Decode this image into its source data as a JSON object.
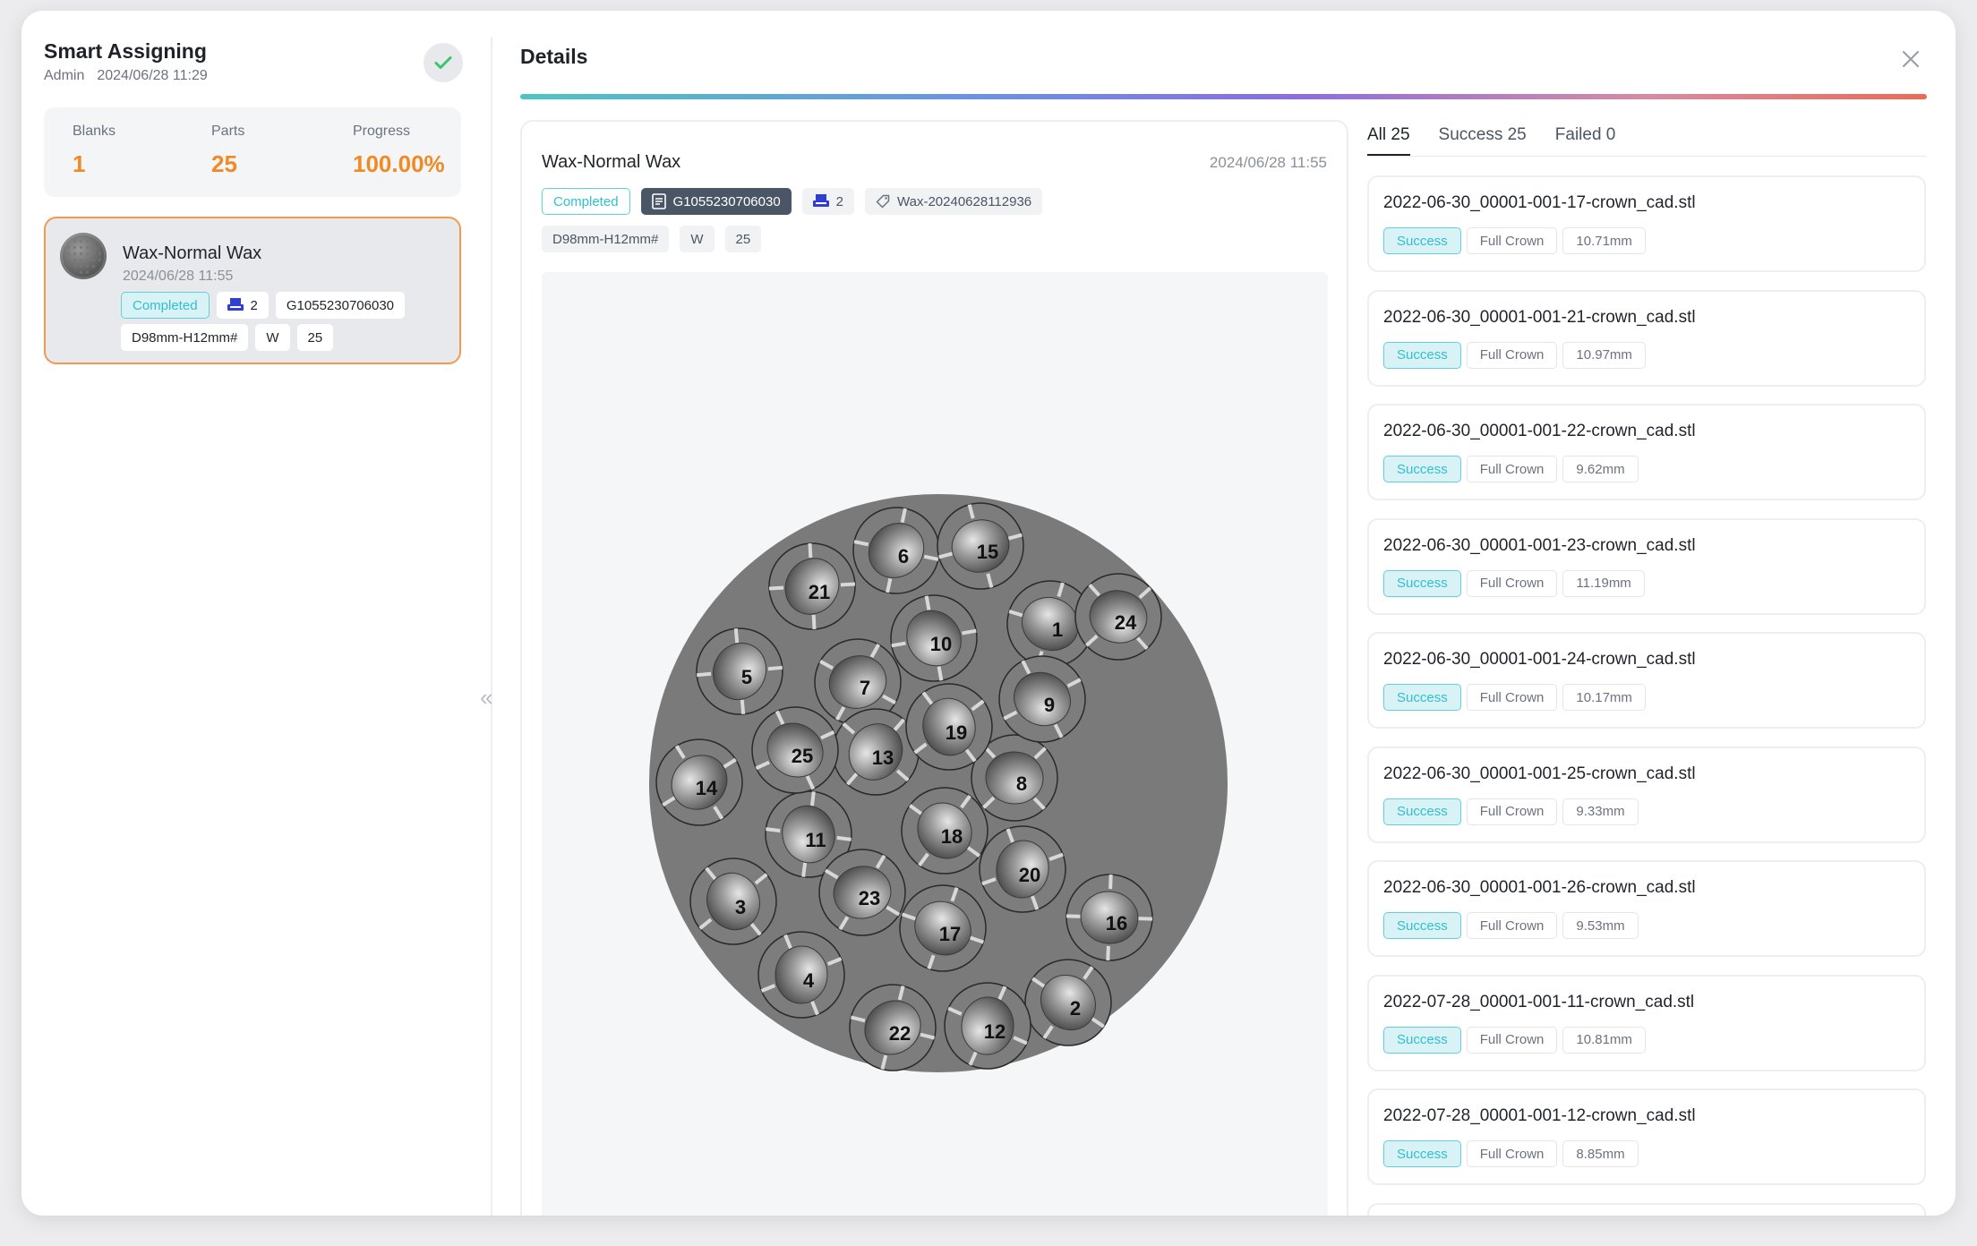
{
  "left": {
    "title": "Smart Assigning",
    "user": "Admin",
    "datetime": "2024/06/28 11:29",
    "stats": [
      {
        "label": "Blanks",
        "value": "1"
      },
      {
        "label": "Parts",
        "value": "25"
      },
      {
        "label": "Progress",
        "value": "100.00%"
      }
    ],
    "job": {
      "name": "Wax-Normal Wax",
      "time": "2024/06/28 11:55",
      "status": "Completed",
      "count": "2",
      "id": "G1055230706030",
      "size": "D98mm-H12mm#",
      "material_code": "W",
      "parts": "25"
    }
  },
  "details": {
    "title": "Details",
    "name": "Wax-Normal Wax",
    "time": "2024/06/28 11:55",
    "status": "Completed",
    "id": "G1055230706030",
    "count": "2",
    "label": "Wax-20240628112936",
    "size": "D98mm-H12mm#",
    "material_code": "W",
    "parts": "25",
    "disc_teeth": [
      "1",
      "2",
      "3",
      "4",
      "5",
      "6",
      "7",
      "8",
      "9",
      "10",
      "11",
      "12",
      "13",
      "14",
      "15",
      "16",
      "17",
      "18",
      "19",
      "20",
      "21",
      "22",
      "23",
      "24",
      "25"
    ]
  },
  "tabs": [
    {
      "label": "All 25"
    },
    {
      "label": "Success 25"
    },
    {
      "label": "Failed 0"
    }
  ],
  "items": [
    {
      "file": "2022-06-30_00001-001-17-crown_cad.stl",
      "status": "Success",
      "type": "Full Crown",
      "height": "10.71mm"
    },
    {
      "file": "2022-06-30_00001-001-21-crown_cad.stl",
      "status": "Success",
      "type": "Full Crown",
      "height": "10.97mm"
    },
    {
      "file": "2022-06-30_00001-001-22-crown_cad.stl",
      "status": "Success",
      "type": "Full Crown",
      "height": "9.62mm"
    },
    {
      "file": "2022-06-30_00001-001-23-crown_cad.stl",
      "status": "Success",
      "type": "Full Crown",
      "height": "11.19mm"
    },
    {
      "file": "2022-06-30_00001-001-24-crown_cad.stl",
      "status": "Success",
      "type": "Full Crown",
      "height": "10.17mm"
    },
    {
      "file": "2022-06-30_00001-001-25-crown_cad.stl",
      "status": "Success",
      "type": "Full Crown",
      "height": "9.33mm"
    },
    {
      "file": "2022-06-30_00001-001-26-crown_cad.stl",
      "status": "Success",
      "type": "Full Crown",
      "height": "9.53mm"
    },
    {
      "file": "2022-07-28_00001-001-11-crown_cad.stl",
      "status": "Success",
      "type": "Full Crown",
      "height": "10.81mm"
    },
    {
      "file": "2022-07-28_00001-001-12-crown_cad.stl",
      "status": "Success",
      "type": "Full Crown",
      "height": "8.85mm"
    }
  ],
  "icons": {
    "check": "check-icon",
    "close": "close-icon",
    "collapse": "double-chevron-left-icon",
    "printer": "printer-icon",
    "file": "file-icon",
    "tag": "tag-icon"
  },
  "colors": {
    "accent_orange": "#f08a24",
    "success_cyan": "#30c0cf",
    "selected_border": "#f29a52"
  }
}
